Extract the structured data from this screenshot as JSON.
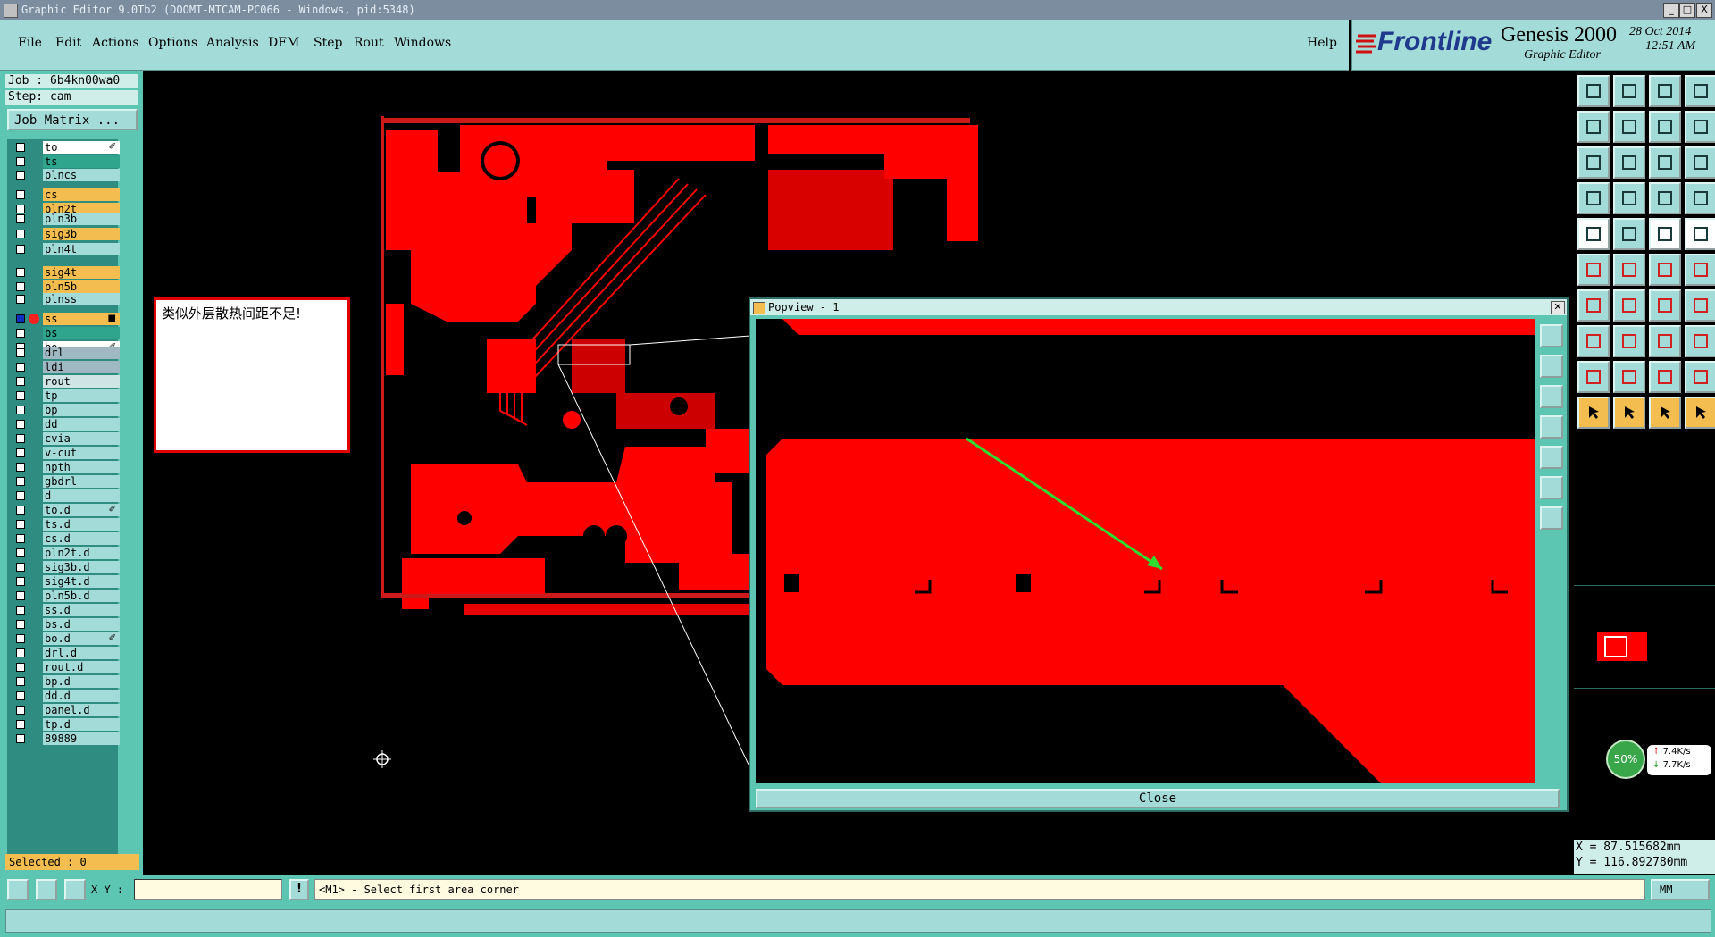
{
  "window": {
    "title": "Graphic Editor 9.0Tb2 (DOOMT-MTCAM-PC066 - Windows, pid:5348)",
    "controls": [
      "_",
      "□",
      "X"
    ]
  },
  "menu": {
    "items": [
      "File",
      "Edit",
      "Actions",
      "Options",
      "Analysis",
      "DFM",
      "Step",
      "Rout",
      "Windows"
    ],
    "help": "Help"
  },
  "brand": {
    "logo": "Frontline",
    "product": "Genesis 2000",
    "subtitle": "Graphic Editor",
    "date": "28 Oct 2014",
    "time": "12:51 AM"
  },
  "job": {
    "job_label": "Job : 6b4kn00wa0",
    "step_label": "Step: cam",
    "matrix_button": "Job Matrix ..."
  },
  "layers": [
    {
      "name": "to",
      "color": "#ffffff",
      "mark": "✐"
    },
    {
      "name": "ts",
      "color": "#2ea58c",
      "mark": ""
    },
    {
      "name": "plncs",
      "color": "#a3dbd8",
      "mark": ""
    },
    {
      "name": "cs",
      "color": "#f3bd4f",
      "mark": ""
    },
    {
      "name": "pln2t",
      "color": "#f3bd4f",
      "mark": ""
    },
    {
      "name": "pln3b",
      "color": "#a3dbd8",
      "mark": ""
    },
    {
      "name": "sig3b",
      "color": "#f3bd4f",
      "mark": ""
    },
    {
      "name": "pln4t",
      "color": "#a3dbd8",
      "mark": ""
    },
    {
      "name": "sig4t",
      "color": "#f3bd4f",
      "mark": ""
    },
    {
      "name": "pln5b",
      "color": "#f3bd4f",
      "mark": ""
    },
    {
      "name": "plnss",
      "color": "#a3dbd8",
      "mark": ""
    },
    {
      "name": "ss",
      "color": "#f3bd4f",
      "mark": "■"
    },
    {
      "name": "bs",
      "color": "#2ea58c",
      "mark": ""
    },
    {
      "name": "bo",
      "color": "#ffffff",
      "mark": "✐"
    },
    {
      "name": "drl",
      "color": "#9fb8c2",
      "mark": ""
    },
    {
      "name": "ldi",
      "color": "#9fb8c2",
      "mark": ""
    },
    {
      "name": "rout",
      "color": "#cfe4e4",
      "mark": ""
    },
    {
      "name": "tp",
      "color": "#a3dbd8",
      "mark": ""
    },
    {
      "name": "bp",
      "color": "#a3dbd8",
      "mark": ""
    },
    {
      "name": "dd",
      "color": "#a3dbd8",
      "mark": ""
    },
    {
      "name": "cvia",
      "color": "#a3dbd8",
      "mark": ""
    },
    {
      "name": "v-cut",
      "color": "#a3dbd8",
      "mark": ""
    },
    {
      "name": "npth",
      "color": "#a3dbd8",
      "mark": ""
    },
    {
      "name": "gbdrl",
      "color": "#a3dbd8",
      "mark": ""
    },
    {
      "name": "d",
      "color": "#a3dbd8",
      "mark": ""
    },
    {
      "name": "to.d",
      "color": "#a3dbd8",
      "mark": "✐"
    },
    {
      "name": "ts.d",
      "color": "#a3dbd8",
      "mark": ""
    },
    {
      "name": "cs.d",
      "color": "#a3dbd8",
      "mark": ""
    },
    {
      "name": "pln2t.d",
      "color": "#a3dbd8",
      "mark": ""
    },
    {
      "name": "sig3b.d",
      "color": "#a3dbd8",
      "mark": ""
    },
    {
      "name": "sig4t.d",
      "color": "#a3dbd8",
      "mark": ""
    },
    {
      "name": "pln5b.d",
      "color": "#a3dbd8",
      "mark": ""
    },
    {
      "name": "ss.d",
      "color": "#a3dbd8",
      "mark": ""
    },
    {
      "name": "bs.d",
      "color": "#a3dbd8",
      "mark": ""
    },
    {
      "name": "bo.d",
      "color": "#a3dbd8",
      "mark": "✐"
    },
    {
      "name": "drl.d",
      "color": "#a3dbd8",
      "mark": ""
    },
    {
      "name": "rout.d",
      "color": "#a3dbd8",
      "mark": ""
    },
    {
      "name": "bp.d",
      "color": "#a3dbd8",
      "mark": ""
    },
    {
      "name": "dd.d",
      "color": "#a3dbd8",
      "mark": ""
    },
    {
      "name": "panel.d",
      "color": "#a3dbd8",
      "mark": ""
    },
    {
      "name": "tp.d",
      "color": "#a3dbd8",
      "mark": ""
    },
    {
      "name": "89889",
      "color": "#a3dbd8",
      "mark": ""
    }
  ],
  "selected": "Selected : 0",
  "note": {
    "text": "类似外层散热间距不足!"
  },
  "popview": {
    "title": "Popview - 1",
    "close_button": "Close"
  },
  "coords": {
    "x": "X = 87.515682mm",
    "y": "Y = 116.892780mm"
  },
  "bottom": {
    "xy_label": "X Y :",
    "xy_value": "",
    "alert": "!",
    "prompt": "<M1> - Select first area corner",
    "units": "MM"
  },
  "network": {
    "percent": "50%",
    "up": "7.4K/s",
    "down": "7.7K/s"
  },
  "colors": {
    "copper": "#ff0000",
    "panel": "#5cc6b2",
    "button": "#a3dbd8",
    "highlight": "#f3bd4f"
  }
}
